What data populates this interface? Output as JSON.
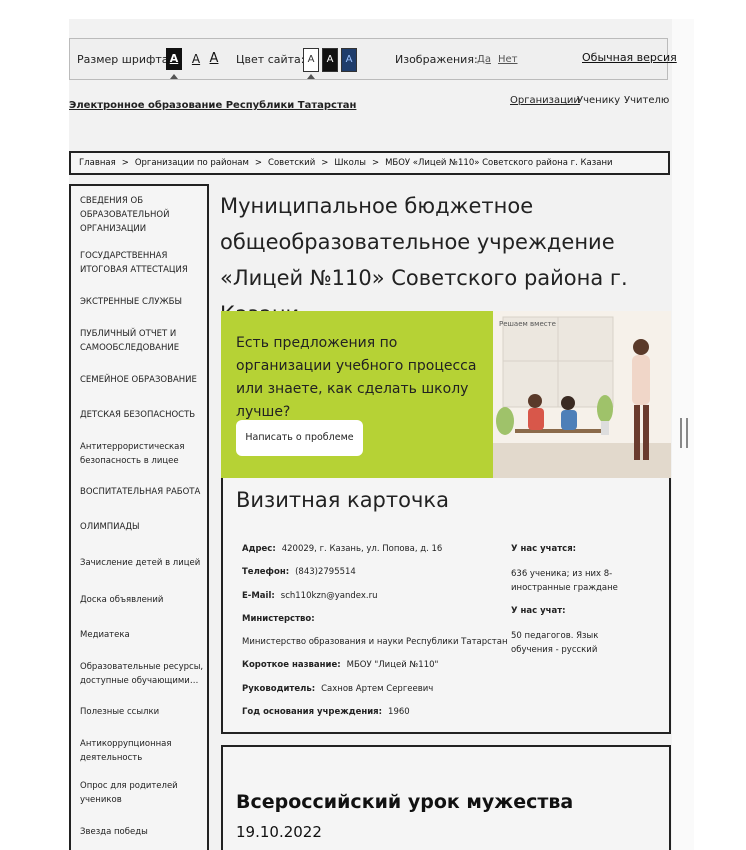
{
  "a11y": {
    "font_size_label": "Размер шрифта:",
    "font_sizes": [
      "A",
      "A",
      "A"
    ],
    "color_label": "Цвет сайта:",
    "colors": [
      "A",
      "A",
      "A"
    ],
    "images_label": "Изображения:",
    "images_yes": "Да",
    "images_no": "Нет",
    "normal_version": "Обычная версия"
  },
  "header": {
    "site_title": "Электронное образование Республики Татарстан",
    "nav": [
      "Организации",
      "Ученику",
      "Учителю"
    ]
  },
  "breadcrumb": [
    "Главная",
    "Организации по районам",
    "Советский",
    "Школы",
    "МБОУ «Лицей №110» Советского района г. Казани"
  ],
  "breadcrumb_sep": ">",
  "sidebar": [
    "СВЕДЕНИЯ ОБ ОБРАЗОВАТЕЛЬНОЙ ОРГАНИЗАЦИИ",
    "ГОСУДАРСТВЕННАЯ ИТОГОВАЯ АТТЕСТАЦИЯ",
    "ЭКСТРЕННЫЕ СЛУЖБЫ",
    "ПУБЛИЧНЫЙ ОТЧЕТ И САМООБСЛЕДОВАНИЕ",
    "СЕМЕЙНОЕ ОБРАЗОВАНИЕ",
    "ДЕТСКАЯ БЕЗОПАСНОСТЬ",
    "Антитеррористическая безопасность в лицее",
    "ВОСПИТАТЕЛЬНАЯ РАБОТА",
    "ОЛИМПИАДЫ",
    "Зачисление детей в лицей",
    "Доска объявлений",
    "Медиатека",
    "Образовательные ресурсы, доступные обучающими…",
    "Полезные ссылки",
    "Антикоррупционная деятельность",
    "Опрос для родителей учеников",
    "Звезда победы"
  ],
  "main": {
    "title": "Муниципальное бюджетное общеобразовательное учреждение «Лицей №110» Советского района г. Казани"
  },
  "banner": {
    "text": "Есть предложения по организации учебного процесса или знаете, как сделать школу лучше?",
    "button": "Написать о проблеме",
    "tag": "Решаем вместе",
    "bg_color": "#b6d235"
  },
  "card": {
    "title": "Визитная карточка",
    "address_label": "Адрес:",
    "address": "420029, г. Казань, ул. Попова, д. 16",
    "phone_label": "Телефон:",
    "phone": "(843)2795514",
    "email_label": "E-Mail:",
    "email": "sch110kzn@yandex.ru",
    "ministry_label": "Министерство:",
    "ministry": "Министерство образования и науки Республики Татарстан",
    "short_name_label": "Короткое название:",
    "short_name": "МБОУ \"Лицей №110\"",
    "director_label": "Руководитель:",
    "director": "Сахнов Артем Сергеевич",
    "founded_label": "Год основания учреждения:",
    "founded": "1960",
    "students_label": "У нас учатся:",
    "students": "636 ученика; из них 8- иностранные граждане",
    "teachers_label": "У нас учат:",
    "teachers": "50 педагогов. Язык обучения - русский"
  },
  "news": {
    "title": "Всероссийский урок мужества",
    "date": "19.10.2022"
  }
}
